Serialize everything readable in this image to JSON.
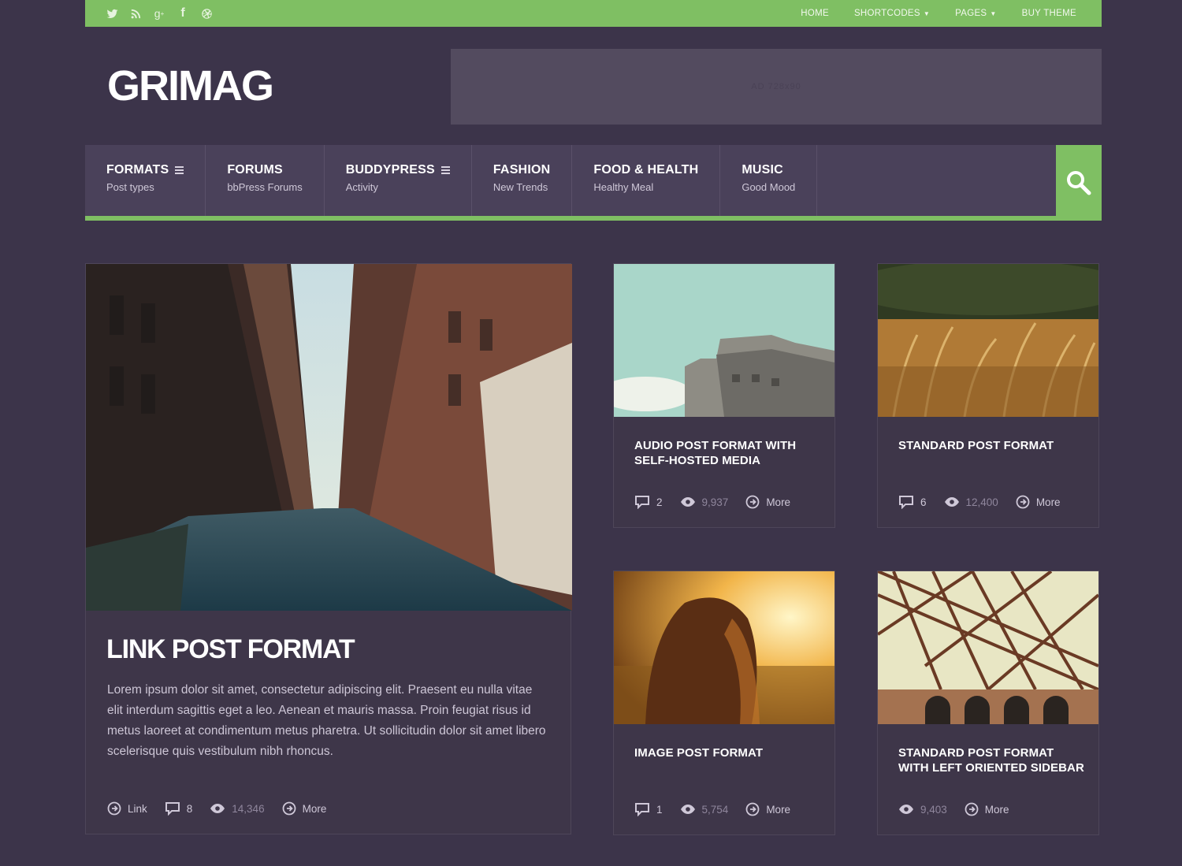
{
  "topbar": {
    "social": [
      "twitter-icon",
      "rss-icon",
      "google-plus-icon",
      "facebook-icon",
      "dribbble-icon"
    ],
    "nav": [
      {
        "label": "HOME",
        "caret": false
      },
      {
        "label": "SHORTCODES",
        "caret": true
      },
      {
        "label": "PAGES",
        "caret": true
      },
      {
        "label": "BUY THEME",
        "caret": false
      }
    ]
  },
  "header": {
    "logo": "GRIMAG",
    "ad_text": "AD 728x90"
  },
  "mainnav": {
    "items": [
      {
        "title": "FORMATS",
        "sub": "Post types",
        "menu": true
      },
      {
        "title": "FORUMS",
        "sub": "bbPress Forums",
        "menu": false
      },
      {
        "title": "BUDDYPRESS",
        "sub": "Activity",
        "menu": true
      },
      {
        "title": "FASHION",
        "sub": "New Trends",
        "menu": false
      },
      {
        "title": "FOOD & HEALTH",
        "sub": "Healthy Meal",
        "menu": false
      },
      {
        "title": "MUSIC",
        "sub": "Good Mood",
        "menu": false
      }
    ]
  },
  "posts": {
    "featured": {
      "title": "LINK POST FORMAT",
      "excerpt": "Lorem ipsum dolor sit amet, consectetur adipiscing elit. Praesent eu nulla vitae elit interdum sagittis eget a leo. Aenean et mauris massa. Proin feugiat risus id metus laoreet at condimentum metus pharetra. Ut sollicitudin dolor sit amet libero scelerisque quis vestibulum nibh rhoncus.",
      "format": "Link",
      "comments": "8",
      "views": "14,346",
      "more": "More"
    },
    "audio": {
      "title_line1": "AUDIO POST FORMAT WITH",
      "title_line2": "SELF-HOSTED MEDIA",
      "comments": "2",
      "views": "9,937",
      "more": "More"
    },
    "standard": {
      "title_line1": "STANDARD POST FORMAT",
      "title_line2": "",
      "comments": "6",
      "views": "12,400",
      "more": "More"
    },
    "image": {
      "title_line1": "IMAGE POST FORMAT",
      "title_line2": "",
      "comments": "1",
      "views": "5,754",
      "more": "More"
    },
    "sidebar": {
      "title_line1": "STANDARD POST FORMAT",
      "title_line2": "WITH LEFT ORIENTED SIDEBAR",
      "views": "9,403",
      "more": "More"
    }
  },
  "colors": {
    "background": "#3c344a",
    "accent_green": "#7fbf63",
    "nav_bg": "#4a415a",
    "card_bg": "#3e3649"
  }
}
